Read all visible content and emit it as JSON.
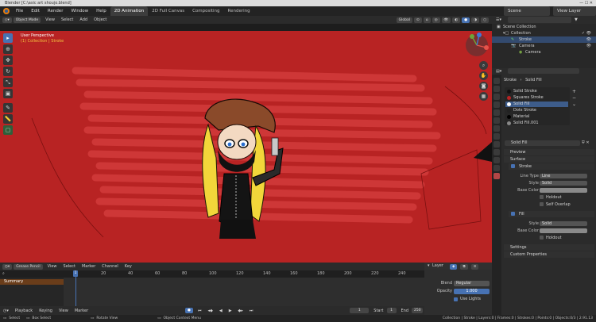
{
  "window": {
    "title": "Blender [C:\\asic art shoujo.blend]"
  },
  "menubar": {
    "items": [
      "File",
      "Edit",
      "Render",
      "Window",
      "Help"
    ],
    "workspaces": [
      "2D Animation",
      "2D Full Canvas",
      "Compositing",
      "Rendering"
    ],
    "scene_label": "Scene",
    "view_layer_label": "View Layer"
  },
  "toolbar_row": {
    "buttons": [
      "Object Mode",
      "View",
      "Select",
      "Add",
      "Object"
    ],
    "transform": "Global"
  },
  "viewport": {
    "title": "User Perspective",
    "subtitle": "(1) Collection | Stroke"
  },
  "outliner": {
    "title": "Scene Collection",
    "rows": [
      "Collection",
      "Stroke",
      "Camera",
      "Camera"
    ]
  },
  "props": {
    "object": "Stroke",
    "data": "Solid Fill",
    "materials": [
      {
        "name": "Solid Stroke",
        "color": "#111111"
      },
      {
        "name": "Squares Stroke",
        "color": "#b82323"
      },
      {
        "name": "Solid Fill",
        "color": "#ffffff"
      },
      {
        "name": "Dots Stroke",
        "color": "#222222"
      },
      {
        "name": "Material",
        "color": "#000000"
      },
      {
        "name": "Solid Fill.001",
        "color": "#888888"
      }
    ],
    "active_material": "Solid Fill",
    "sections": {
      "preview": "Preview",
      "surface": "Surface",
      "stroke": "Stroke",
      "fill": "Fill",
      "settings": "Settings",
      "custom": "Custom Properties"
    },
    "stroke_fields": {
      "line_type_label": "Line Type",
      "line_type": "Line",
      "style_label": "Style",
      "style": "Solid",
      "base_color_label": "Base Color",
      "holdout": "Holdout",
      "self_overlap": "Self Overlap"
    },
    "fill_fields": {
      "style_label": "Style",
      "style": "Solid",
      "base_color_label": "Base Color",
      "holdout": "Holdout"
    }
  },
  "timeline": {
    "header_items": [
      "Playback",
      "Keying",
      "View",
      "Marker"
    ],
    "header_menus": [
      "View",
      "Select",
      "Marker",
      "Channel",
      "Key"
    ],
    "mode": "Grease Pencil",
    "summary": "Summary",
    "current_frame": "1",
    "ticks": [
      "0",
      "20",
      "40",
      "60",
      "80",
      "100",
      "120",
      "140",
      "160",
      "180",
      "200",
      "220",
      "240"
    ],
    "start_label": "Start",
    "start": "1",
    "end_label": "End",
    "end": "250"
  },
  "layer_panel": {
    "title": "Layer",
    "blend_label": "Blend",
    "blend": "Regular",
    "opacity_label": "Opacity",
    "opacity": "1.000",
    "use_lights": "Use Lights"
  },
  "statusbar": {
    "left": [
      "Select",
      "Box Select",
      "Rotate View",
      "Object Context Menu"
    ],
    "right": "Collection | Stroke | Layers:0 | Frames:0 | Strokes:0 | Points:0 | Objects:0/3 | 2.91.13"
  }
}
